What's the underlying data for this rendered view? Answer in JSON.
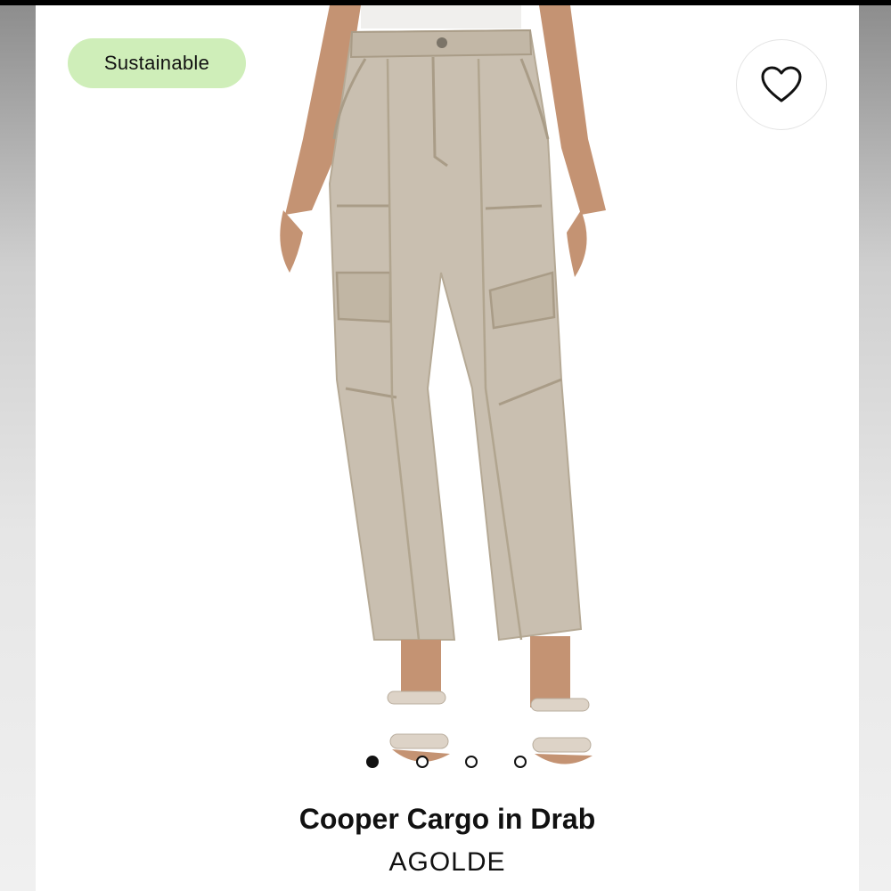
{
  "badge": {
    "label": "Sustainable",
    "color": "#cfeeb9"
  },
  "favorite": {
    "icon": "heart-icon"
  },
  "carousel": {
    "count": 4,
    "active_index": 1
  },
  "product": {
    "title": "Cooper Cargo in Drab",
    "brand": "AGOLDE"
  },
  "colors": {
    "pants": "#c9bfb0",
    "skin": "#c49373",
    "accent_text": "#111111"
  }
}
